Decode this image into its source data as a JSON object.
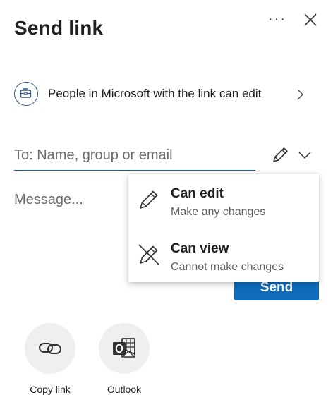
{
  "panel": {
    "title": "Send link"
  },
  "header": {
    "more_label": "···"
  },
  "permission": {
    "text": "People in Microsoft with the link can edit"
  },
  "recipient": {
    "placeholder": "To: Name, group or email"
  },
  "message": {
    "placeholder": "Message..."
  },
  "send": {
    "label": "Send"
  },
  "dropdown": {
    "items": [
      {
        "title": "Can edit",
        "subtitle": "Make any changes",
        "icon": "pencil-icon"
      },
      {
        "title": "Can view",
        "subtitle": "Cannot make changes",
        "icon": "pencil-crossed-icon"
      }
    ]
  },
  "share_options": [
    {
      "label": "Copy link",
      "icon": "link-icon"
    },
    {
      "label": "Outlook",
      "icon": "outlook-icon"
    }
  ],
  "colors": {
    "accent": "#0f6cbd",
    "input_underline": "#1a5fb4",
    "circle_bg": "#efefef"
  }
}
